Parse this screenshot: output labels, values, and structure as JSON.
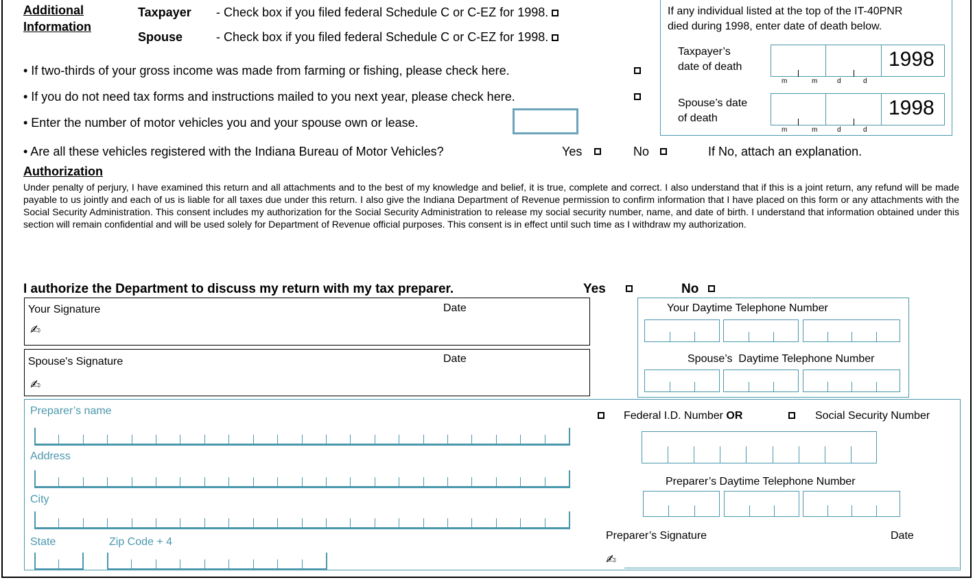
{
  "additional": {
    "heading_line1": "Additional",
    "heading_line2": "Information",
    "taxpayer_label": "Taxpayer",
    "taxpayer_text": "- Check box if you filed federal Schedule C or C-EZ for 1998.",
    "spouse_label": "Spouse",
    "spouse_text": "- Check box if you filed federal Schedule C or C-EZ for 1998.",
    "farming": "• If two-thirds of your gross income was made from farming or fishing, please check here.",
    "no_forms": "• If you do not need tax forms and instructions mailed to you next year, please check here.",
    "vehicles": "• Enter the number of motor vehicles you and your spouse own or lease.",
    "registered": "• Are all these vehicles registered with the Indiana Bureau of Motor Vehicles?",
    "yes": "Yes",
    "no": "No",
    "explain": "If No, attach an explanation."
  },
  "death": {
    "intro_line1": "If any individual listed at the top of the IT-40PNR",
    "intro_line2": "died during 1998, enter date of death below.",
    "taxpayer_line1": "Taxpayer’s",
    "taxpayer_line2": "date of death",
    "spouse_line1": "Spouse’s date",
    "spouse_line2": "of death",
    "year": "1998",
    "m": "m",
    "d": "d"
  },
  "authorization": {
    "heading": "Authorization",
    "paragraph": "Under penalty of perjury, I have examined this return and all attachments and to the best of my knowledge and belief, it is true, complete and correct. I also understand that if this is a joint return, any refund will be made payable to us jointly and each of us is liable for all taxes due under this return. I also give the Indiana Department of Revenue permission to confirm information that I have placed on this form or any attachments with the Social Security Administration. This consent includes my authorization for the Social Security Administration to release my social security number, name, and date of birth. I understand that information obtained under this section will remain confidential and will be used solely for Department of Revenue official purposes. This consent is in effect until such time as I withdraw my authorization.",
    "preparer_question": "I authorize the Department to discuss my return with my tax preparer.",
    "yes": "Yes",
    "no": "No"
  },
  "signatures": {
    "your_signature": "Your Signature",
    "spouse_signature": "Spouse's Signature",
    "date": "Date",
    "your_phone": "Your Daytime Telephone Number",
    "spouse_phone": "Spouse’s  Daytime Telephone Number",
    "pen_icon": "pen-icon"
  },
  "preparer": {
    "name": "Preparer’s name",
    "address": "Address",
    "city": "City",
    "state": "State",
    "zip": "Zip Code + 4",
    "federal_id": "Federal  I.D. Number",
    "or": "OR",
    "ssn": "Social Security Number",
    "phone": "Preparer’s Daytime Telephone Number",
    "signature": "Preparer’s Signature",
    "date": "Date"
  },
  "colors": {
    "teal": "#4a97ad"
  }
}
